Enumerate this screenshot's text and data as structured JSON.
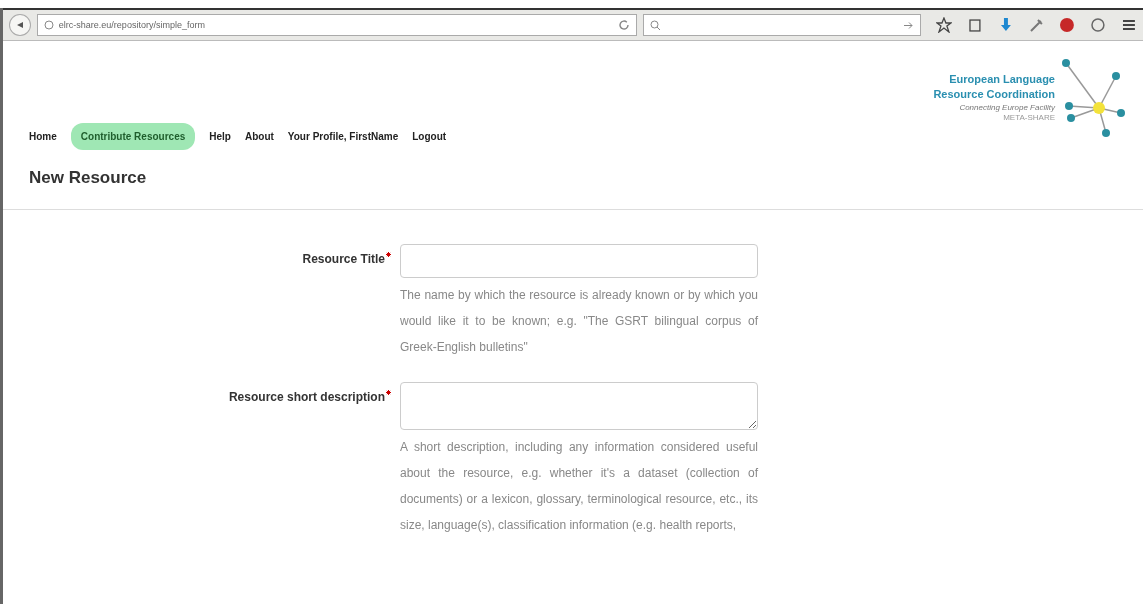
{
  "browser": {
    "url": "elrc-share.eu/repository/simple_form"
  },
  "logo": {
    "line1": "European Language",
    "line2": "Resource Coordination",
    "tagline": "Connecting Europe Facility",
    "sub": "META-SHARE"
  },
  "nav": [
    {
      "label": "Home",
      "selected": false
    },
    {
      "label": "Contribute Resources",
      "selected": true
    },
    {
      "label": "Help",
      "selected": false
    },
    {
      "label": "About",
      "selected": false
    },
    {
      "label": "Your Profile, FirstName",
      "selected": false
    },
    {
      "label": "Logout",
      "selected": false
    }
  ],
  "page_title": "New Resource",
  "fields": [
    {
      "kind": "input",
      "label": "Resource Title",
      "required": true,
      "help": "The name by which the resource is already known or by which you would like it to be known; e.g. \"The GSRT bilingual corpus of Greek-English bulletins\""
    },
    {
      "kind": "textarea",
      "label": "Resource short description",
      "required": true,
      "help": "A short description, including any information considered useful about the resource, e.g. whether it's a dataset (collection of documents) or a lexicon, glossary, terminological resource, etc., its size, language(s), classification information (e.g. health reports,"
    }
  ]
}
